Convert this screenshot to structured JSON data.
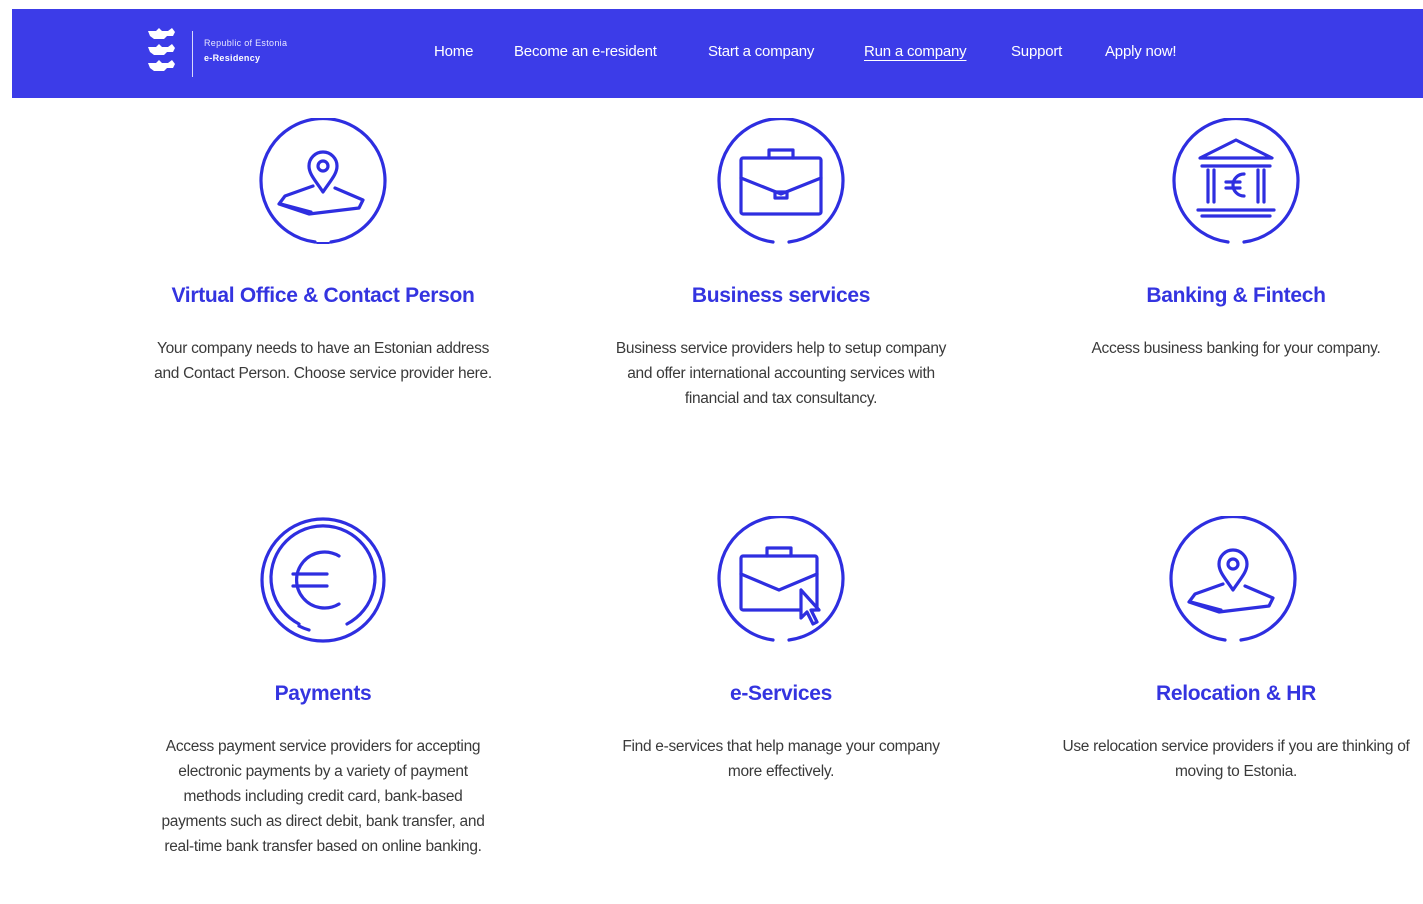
{
  "header": {
    "logo_line1": "Republic of Estonia",
    "logo_line2": "e-Residency",
    "nav": [
      {
        "label": "Home"
      },
      {
        "label": "Become an e-resident"
      },
      {
        "label": "Start a company"
      },
      {
        "label": "Run a company"
      },
      {
        "label": "Support"
      },
      {
        "label": "Apply now!"
      }
    ],
    "active_nav": "Run a company"
  },
  "cards": [
    {
      "icon": "location-pin-icon",
      "title": "Virtual Office & Contact Person",
      "text": "Your company needs to have an Estonian address and Contact Person. Choose service provider here."
    },
    {
      "icon": "briefcase-icon",
      "title": "Business services",
      "text": "Business service providers help to setup company and offer international accounting services with financial and tax consultancy."
    },
    {
      "icon": "bank-euro-icon",
      "title": "Banking & Fintech",
      "text": "Access business banking for your company."
    },
    {
      "icon": "euro-coin-icon",
      "title": "Payments",
      "text": "Access payment service providers for accepting electronic payments by a variety of payment methods including credit card, bank-based payments such as direct debit, bank transfer, and real-time bank transfer based on online banking."
    },
    {
      "icon": "briefcase-cursor-icon",
      "title": "e-Services",
      "text": "Find e-services that help manage your company more effectively."
    },
    {
      "icon": "location-pin-icon",
      "title": "Relocation & HR",
      "text": "Use relocation service providers if you are thinking of moving to Estonia."
    }
  ],
  "colors": {
    "brand": "#3c3ce8",
    "heading": "#3434e0",
    "body_text": "#3a3a3a",
    "icon_stroke": "#2e2ee0"
  }
}
